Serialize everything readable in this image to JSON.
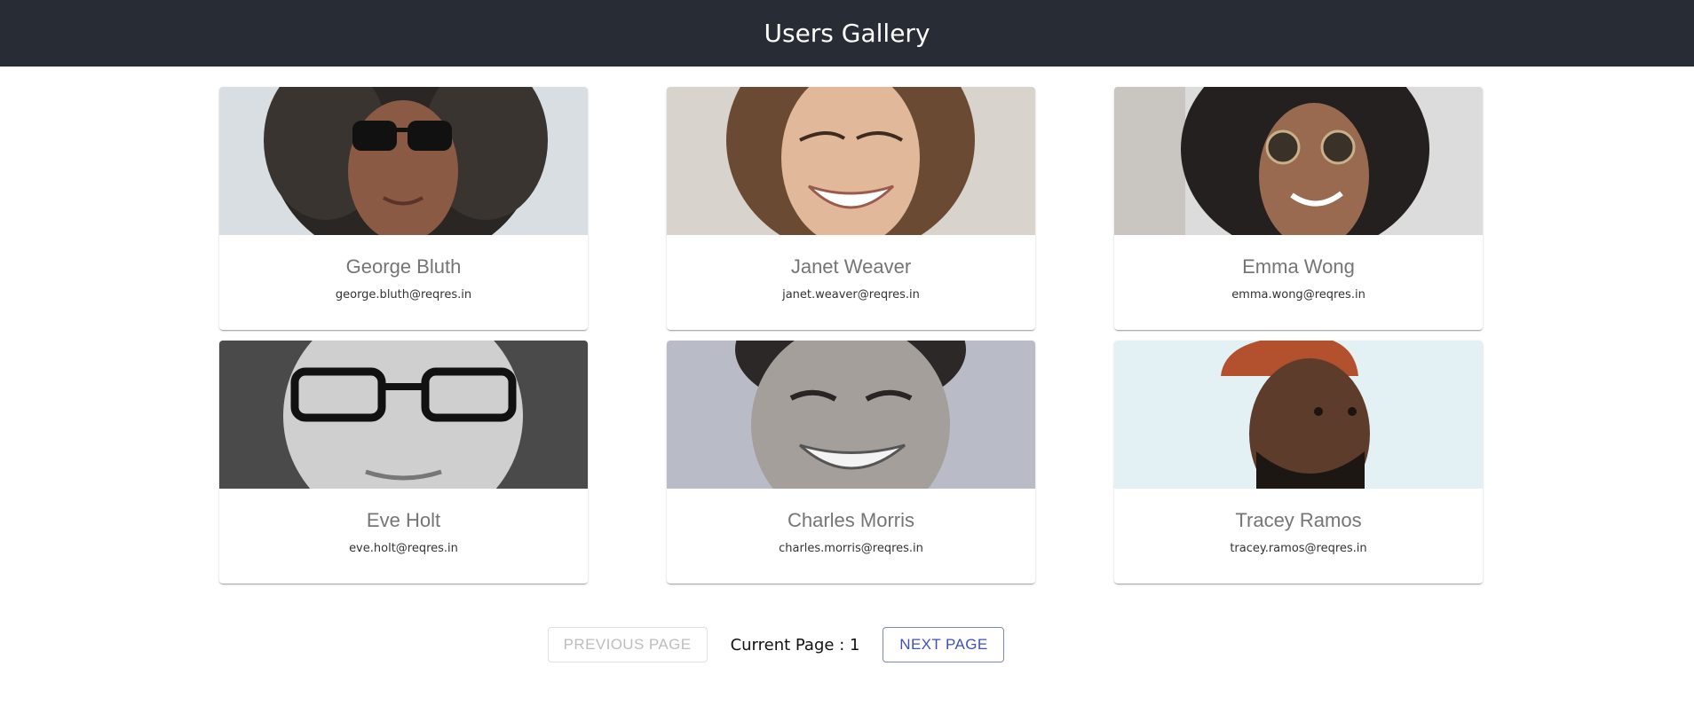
{
  "header": {
    "title": "Users Gallery"
  },
  "users": [
    {
      "name": "George Bluth",
      "email": "george.bluth@reqres.in"
    },
    {
      "name": "Janet Weaver",
      "email": "janet.weaver@reqres.in"
    },
    {
      "name": "Emma Wong",
      "email": "emma.wong@reqres.in"
    },
    {
      "name": "Eve Holt",
      "email": "eve.holt@reqres.in"
    },
    {
      "name": "Charles Morris",
      "email": "charles.morris@reqres.in"
    },
    {
      "name": "Tracey Ramos",
      "email": "tracey.ramos@reqres.in"
    }
  ],
  "pagination": {
    "previous_label": "PREVIOUS PAGE",
    "current_label": "Current Page : 1",
    "next_label": "NEXT PAGE",
    "previous_disabled": true
  },
  "colors": {
    "header_bg": "#282c34",
    "accent": "#3f51b5"
  }
}
